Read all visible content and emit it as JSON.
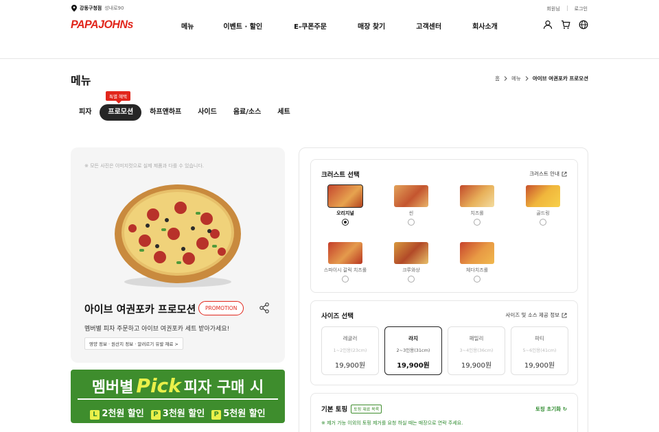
{
  "header": {
    "store_name": "강동구청점",
    "store_address": "성내로90",
    "util_signup": "회원님",
    "util_login": "로그인",
    "logo_text": "PAPAJOHNs",
    "nav": [
      "메뉴",
      "이벤트 · 할인",
      "E-쿠폰주문",
      "매장 찾기",
      "고객센터",
      "회사소개"
    ]
  },
  "page": {
    "title": "메뉴",
    "breadcrumb": [
      "홈",
      "메뉴",
      "아이브 여권포카 프로모션"
    ]
  },
  "tabs": {
    "badge": "특별 혜택",
    "items": [
      "피자",
      "프로모션",
      "하프앤하프",
      "사이드",
      "음료/소스",
      "세트"
    ],
    "active_index": 1
  },
  "product": {
    "notice": "※ 모든 사진은 이미지컷으로 실제 제품과 다를 수 있습니다.",
    "title": "아이브 여권포카 프로모션",
    "chip": "PROMOTION",
    "desc": "멤버별 피자 주문하고 아이브 여권포카 세트 받아가세요!",
    "info_button": "영양 정보 · 원산지 정보 · 알러르기 유발 재료 >"
  },
  "banner": {
    "line1_pre": "멤버별",
    "line1_pick": "Pick",
    "line1_post": "피자 구매 시",
    "discounts": [
      {
        "icon": "L",
        "text": "2천원 할인"
      },
      {
        "icon": "P",
        "text": "3천원 할인"
      },
      {
        "icon": "P",
        "text": "5천원 할인"
      }
    ]
  },
  "crust": {
    "title": "크러스트 선택",
    "link": "크러스트 안내",
    "options": [
      "오리지널",
      "씬",
      "치즈롤",
      "골드링",
      "스파이시 갈릭 치즈롤",
      "크루와상",
      "체다치즈롤"
    ],
    "selected_index": 0
  },
  "size": {
    "title": "사이즈 선택",
    "link": "사이즈 및 소스 제공 정보",
    "options": [
      {
        "name": "레귤러",
        "desc": "1~2인용(23cm)",
        "price": "19,900원"
      },
      {
        "name": "라지",
        "desc": "2~3인용(31cm)",
        "price": "19,900원"
      },
      {
        "name": "패밀리",
        "desc": "3~4인용(36cm)",
        "price": "19,900원"
      },
      {
        "name": "파티",
        "desc": "5~6인용(41cm)",
        "price": "19,900원"
      }
    ],
    "selected_index": 1
  },
  "topping": {
    "title": "기본 토핑",
    "badge": "토핑 재료 목록",
    "reset": "토핑 초기화",
    "note": "※ 제거 가능 이외의 토핑 제거를 요청 하실 때는 매장으로 연락 주세요."
  },
  "colors": {
    "brand_red": "#e1261c",
    "banner_green": "#3e8d2d",
    "pick_yellow": "#e9f04a",
    "active_tab": "#262626"
  }
}
